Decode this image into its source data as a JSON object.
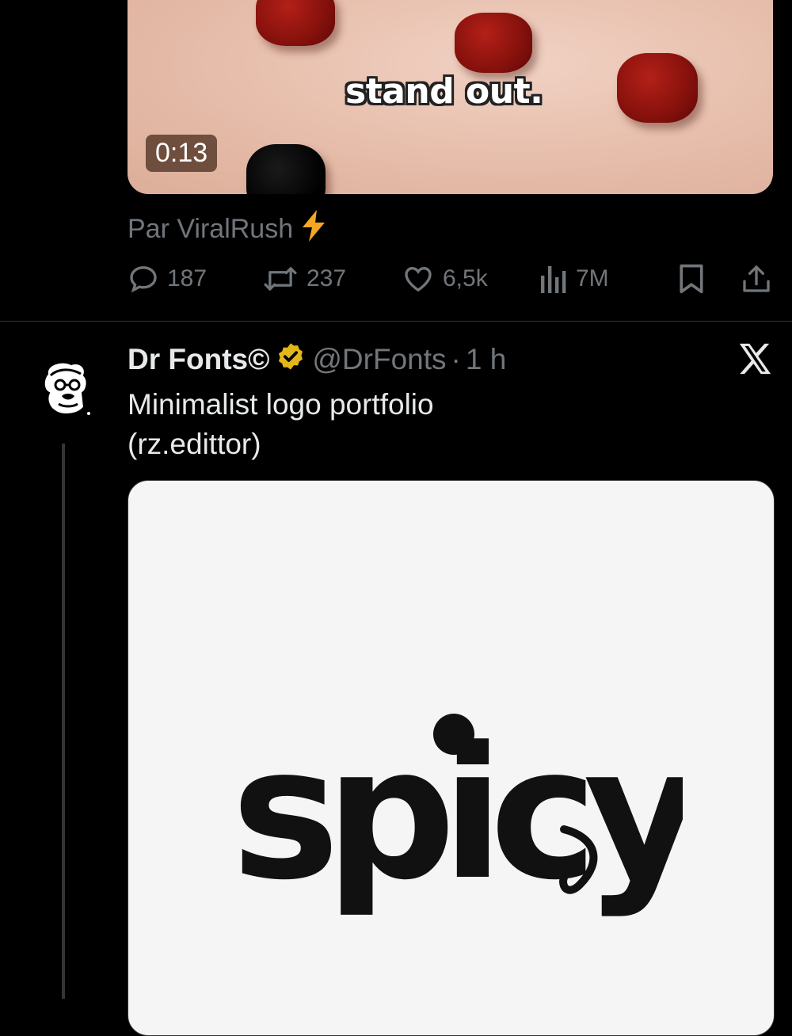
{
  "tweet1": {
    "video": {
      "caption": "stand out.",
      "duration": "0:13"
    },
    "source": {
      "text": "Par ViralRush",
      "icon": "lightning-bolt-icon",
      "icon_color": "#f5a623"
    },
    "actions": {
      "replies": "187",
      "reposts": "237",
      "likes": "6,5k",
      "views": "7M",
      "bookmark_icon": "bookmark-icon",
      "share_icon": "share-icon"
    }
  },
  "tweet2": {
    "author": {
      "display_name": "Dr Fonts©",
      "handle": "@DrFonts",
      "verified_icon": "gold-verified-badge-icon",
      "verified_color": "#e2b719"
    },
    "separator": "·",
    "time": "1 h",
    "text_lines": [
      "Minimalist logo portfolio",
      "(rz.edittor)"
    ],
    "media": {
      "logo_text": "spicy"
    },
    "platform_icon": "x-logo-icon"
  },
  "colors": {
    "background": "#000000",
    "primary_text": "#e7e9ea",
    "secondary_text": "#71767b",
    "divider": "#2f3336"
  }
}
